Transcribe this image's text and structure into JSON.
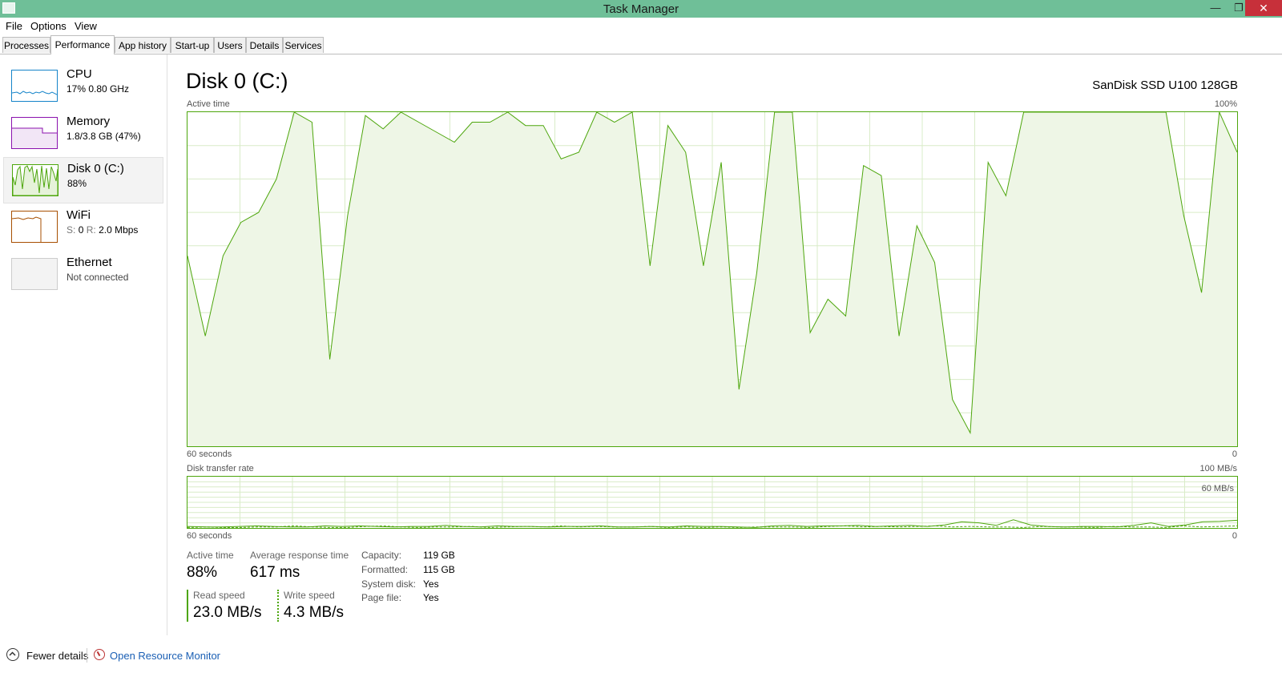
{
  "window": {
    "title": "Task Manager"
  },
  "menu": [
    "File",
    "Options",
    "View"
  ],
  "tabs": [
    "Processes",
    "Performance",
    "App history",
    "Start-up",
    "Users",
    "Details",
    "Services"
  ],
  "sidebar": {
    "items": [
      {
        "name": "CPU",
        "sub": "17% 0.80 GHz",
        "color": "#1584c9"
      },
      {
        "name": "Memory",
        "sub": "1.8/3.8 GB (47%)",
        "color": "#8b12ae"
      },
      {
        "name": "Disk 0 (C:)",
        "sub": "88%",
        "color": "#4da60c"
      },
      {
        "name": "WiFi",
        "sub_s_label": "S:",
        "sub_s_val": "0",
        "sub_r_label": "R:",
        "sub_r_val": "2.0 Mbps",
        "color": "#a74f01"
      },
      {
        "name": "Ethernet",
        "sub": "Not connected",
        "color": "#cccccc"
      }
    ]
  },
  "main": {
    "title": "Disk 0 (C:)",
    "model": "SanDisk SSD U100 128GB",
    "active_chart": {
      "label": "Active time",
      "max_label": "100%",
      "x_left": "60 seconds",
      "x_right": "0"
    },
    "transfer_chart": {
      "label": "Disk transfer rate",
      "max_label": "100 MB/s",
      "mid_label": "60 MB/s",
      "x_left": "60 seconds",
      "x_right": "0"
    },
    "stats": {
      "active_time_label": "Active time",
      "active_time": "88%",
      "response_label": "Average response time",
      "response": "617 ms",
      "read_label": "Read speed",
      "read": "23.0 MB/s",
      "write_label": "Write speed",
      "write": "4.3 MB/s"
    },
    "info": [
      {
        "key": "Capacity:",
        "value": "119 GB"
      },
      {
        "key": "Formatted:",
        "value": "115 GB"
      },
      {
        "key": "System disk:",
        "value": "Yes"
      },
      {
        "key": "Page file:",
        "value": "Yes"
      }
    ]
  },
  "footer": {
    "fewer_details": "Fewer details",
    "resource_monitor": "Open Resource Monitor"
  },
  "chart_data": [
    {
      "type": "area",
      "title": "Active time",
      "ylabel": "Active time (%)",
      "xlabel": "seconds",
      "ylim": [
        0,
        100
      ],
      "xlim": [
        60,
        0
      ],
      "color": "#4da60c",
      "series": [
        {
          "values": [
            57,
            33,
            57,
            67,
            70,
            80,
            100,
            97,
            26,
            69,
            99,
            95,
            100,
            97,
            94,
            91,
            97,
            97,
            100,
            96,
            96,
            86,
            88,
            100,
            97,
            100,
            54,
            96,
            88,
            54,
            85,
            17,
            52,
            100,
            100,
            34,
            44,
            39,
            84,
            81,
            33,
            66,
            55,
            14,
            4,
            85,
            75,
            100,
            100,
            100,
            100,
            100,
            100,
            100,
            100,
            100,
            69,
            46,
            100,
            88
          ]
        }
      ]
    },
    {
      "type": "line",
      "title": "Disk transfer rate",
      "ylabel": "MB/s",
      "xlabel": "seconds",
      "ylim": [
        0,
        100
      ],
      "xlim": [
        60,
        0
      ],
      "color": "#4da60c",
      "series": [
        {
          "name": "Read speed",
          "values": [
            3,
            2,
            2,
            3,
            4,
            3,
            2,
            2,
            4,
            3,
            4,
            3,
            2,
            3,
            3,
            5,
            3,
            2,
            4,
            3,
            3,
            2,
            3,
            3,
            4,
            2,
            2,
            3,
            2,
            4,
            3,
            3,
            2,
            1,
            4,
            5,
            3,
            4,
            4,
            5,
            3,
            4,
            5,
            3,
            6,
            12,
            10,
            5,
            16,
            6,
            3,
            2,
            3,
            3,
            2,
            5,
            10,
            3,
            6,
            12,
            13,
            15
          ]
        },
        {
          "name": "Write speed",
          "values": [
            1,
            2,
            1,
            1,
            2,
            2,
            4,
            2,
            1,
            1,
            3,
            4,
            2,
            1,
            2,
            2,
            3,
            1,
            2,
            3,
            2,
            4,
            2,
            3,
            2,
            2,
            3,
            1,
            2,
            1,
            2,
            1,
            2,
            2,
            2,
            1,
            3,
            4,
            2,
            3,
            2,
            3,
            4,
            2,
            3,
            2,
            2,
            1,
            3,
            2,
            2,
            1,
            3,
            2,
            2,
            1,
            4,
            2,
            3,
            4
          ]
        }
      ]
    }
  ]
}
